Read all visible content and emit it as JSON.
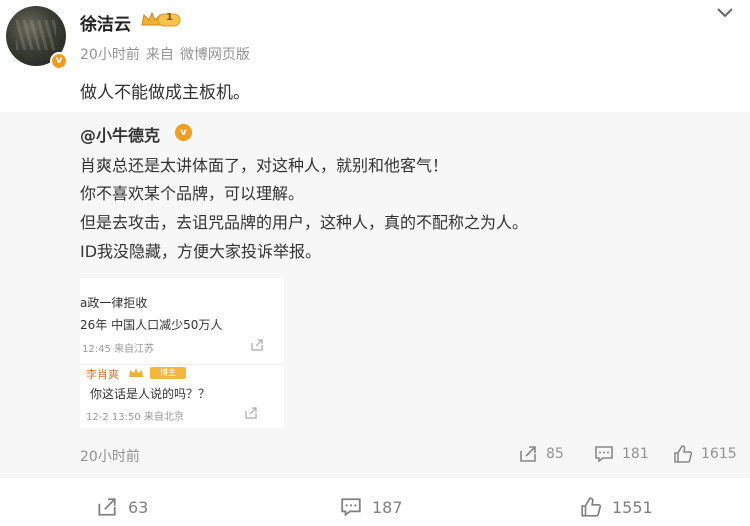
{
  "post": {
    "username": "徐洁云",
    "level_badge": "1",
    "time": "20小时前",
    "source_prefix": "来自",
    "source": "微博网页版",
    "verified_mark": "v",
    "text": "做人不能做成主板机。"
  },
  "repost": {
    "author": "@小牛德克",
    "verified_mark": "v",
    "lines": [
      "肖爽总还是太讲体面了，对这种人，就别和他客气！",
      "你不喜欢某个品牌，可以理解。",
      "但是去攻击，去诅咒品牌的用户，这种人，真的不配称之为人。",
      "ID我没隐藏，方便大家投诉举报。"
    ],
    "image": {
      "line1": "a政一律拒收",
      "line2": "26年 中国人口减少50万人",
      "meta1": "12:45 来自江苏",
      "reply_name": "李肖爽",
      "reply_tag": "博主",
      "reply_text": "你这话是人说的吗？？",
      "meta2": "12-2 13:50 来自北京"
    },
    "time": "20小时前",
    "repost_count": "85",
    "comment_count": "181",
    "like_count": "1615"
  },
  "bottom": {
    "repost_count": "63",
    "comment_count": "187",
    "like_count": "1551"
  },
  "colors": {
    "accent_orange": "#f39c1f",
    "gray_text": "#939393",
    "repost_bg": "#f7f7f7"
  },
  "icons": [
    "chevron-down-icon",
    "crown-icon",
    "verified-icon",
    "share-icon",
    "comment-icon",
    "like-icon"
  ]
}
